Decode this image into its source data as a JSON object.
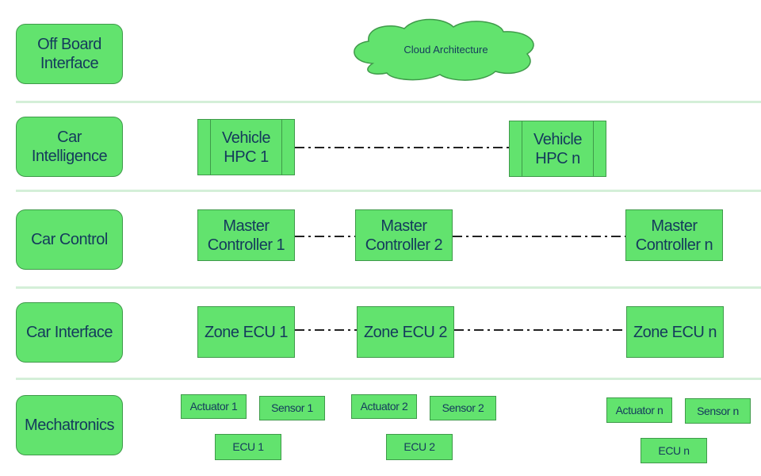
{
  "colors": {
    "fill": "#62e36e",
    "border": "#3f9a4a",
    "text": "#143a5c",
    "separator": "#d4efd8"
  },
  "layers": [
    {
      "label": "Off Board\nInterface"
    },
    {
      "label": "Car\nIntelligence"
    },
    {
      "label": "Car Control"
    },
    {
      "label": "Car Interface"
    },
    {
      "label": "Mechatronics"
    }
  ],
  "cloud": {
    "label": "Cloud Architecture"
  },
  "intelligence": [
    "Vehicle\nHPC 1",
    "Vehicle\nHPC n"
  ],
  "control": [
    "Master\nController 1",
    "Master\nController 2",
    "Master\nController n"
  ],
  "interface": [
    "Zone ECU 1",
    "Zone ECU 2",
    "Zone ECU n"
  ],
  "mechatronics": [
    {
      "actuator": "Actuator 1",
      "sensor": "Sensor 1",
      "ecu": "ECU 1"
    },
    {
      "actuator": "Actuator 2",
      "sensor": "Sensor 2",
      "ecu": "ECU 2"
    },
    {
      "actuator": "Actuator n",
      "sensor": "Sensor n",
      "ecu": "ECU n"
    }
  ]
}
